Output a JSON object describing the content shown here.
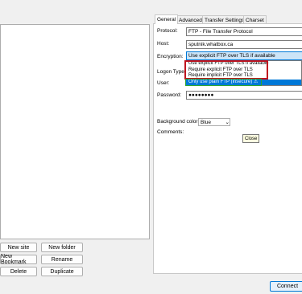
{
  "tabs": [
    "General",
    "Advanced",
    "Transfer Settings",
    "Charset"
  ],
  "form": {
    "protocol_label": "Protocol:",
    "protocol_value": "FTP - File Transfer Protocol",
    "host_label": "Host:",
    "host_value": "sputnik.whatbox.ca",
    "encryption_label": "Encryption:",
    "encryption_value": "Use explicit FTP over TLS if available",
    "logon_type_label": "Logon Type:",
    "user_label": "User:",
    "password_label": "Password:",
    "password_value": "●●●●●●●●",
    "background_color_label": "Background color:",
    "background_color_value": "Blue",
    "comments_label": "Comments:"
  },
  "encryption_options": [
    "Use explicit FTP over TLS if available",
    "Require explicit FTP over TLS",
    "Require implicit FTP over TLS",
    "Only use plain FTP (insecure) ⚠"
  ],
  "tooltip": "Close",
  "buttons": {
    "new_site": "New site",
    "new_folder": "New folder",
    "new_bookmark": "New Bookmark",
    "rename": "Rename",
    "delete": "Delete",
    "duplicate": "Duplicate",
    "connect": "Connect"
  },
  "colors": {
    "selection": "#0078d7",
    "highlight_red": "#c0141e",
    "highlight_green": "#2fa52f"
  }
}
